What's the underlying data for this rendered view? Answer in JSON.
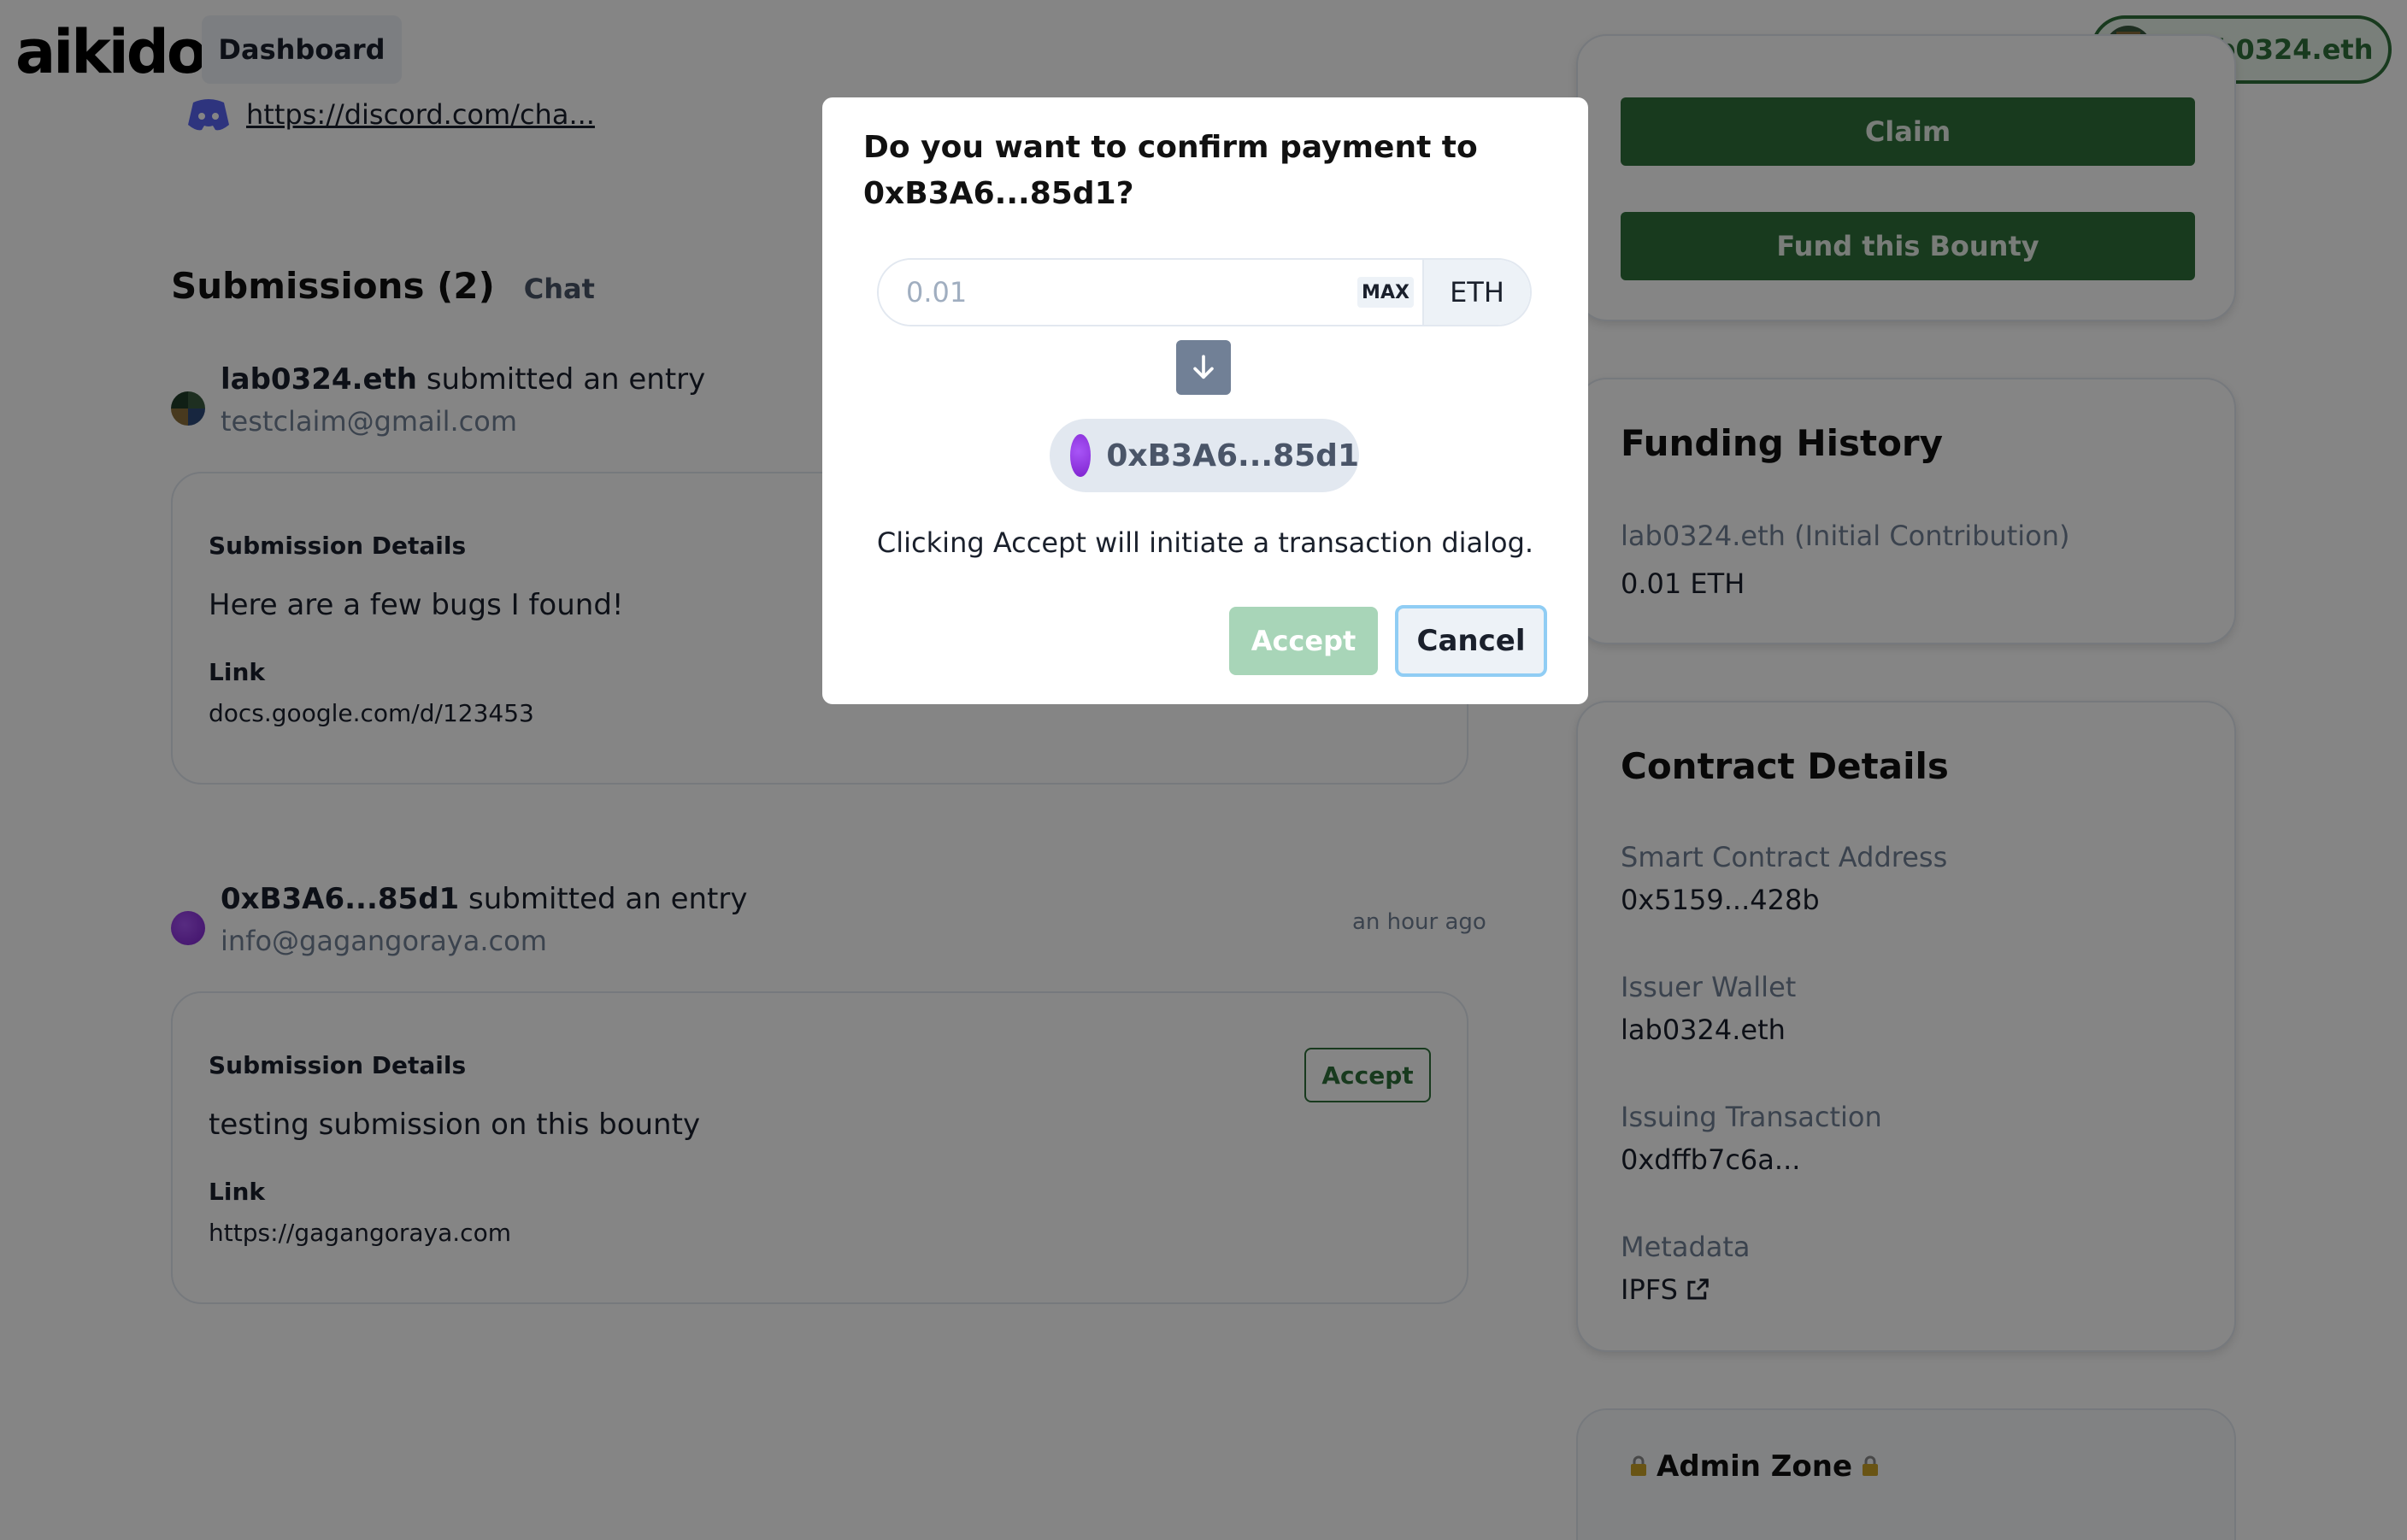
{
  "header": {
    "logo": "aikido",
    "nav_dashboard": "Dashboard",
    "wallet_label": "lab0324.eth"
  },
  "links": {
    "discord": "https://discord.com/cha..."
  },
  "submissions": {
    "title": "Submissions (2)",
    "chat_tab": "Chat",
    "entries": [
      {
        "author": "lab0324.eth",
        "action": "submitted an entry",
        "email": "testclaim@gmail.com",
        "time": "",
        "details_label": "Submission Details",
        "details_text": "Here are a few bugs I found!",
        "link_label": "Link",
        "link_value": "docs.google.com/d/123453",
        "accept_label": ""
      },
      {
        "author": "0xB3A6...85d1",
        "action": "submitted an entry",
        "email": "info@gagangoraya.com",
        "time": "an hour ago",
        "details_label": "Submission Details",
        "details_text": "testing submission on this bounty",
        "link_label": "Link",
        "link_value": "https://gagangoraya.com",
        "accept_label": "Accept"
      }
    ]
  },
  "actions": {
    "claim": "Claim",
    "fund": "Fund this Bounty"
  },
  "funding_history": {
    "title": "Funding History",
    "contributor": "lab0324.eth (Initial Contribution)",
    "amount": "0.01 ETH"
  },
  "contract_details": {
    "title": "Contract Details",
    "address_label": "Smart Contract Address",
    "address_value": "0x5159...428b",
    "issuer_label": "Issuer Wallet",
    "issuer_value": "lab0324.eth",
    "tx_label": "Issuing Transaction",
    "tx_value": "0xdffb7c6a...",
    "metadata_label": "Metadata",
    "metadata_value": "IPFS"
  },
  "admin": {
    "title": "Admin Zone"
  },
  "modal": {
    "title": "Do you want to confirm payment to 0xB3A6...85d1?",
    "amount_placeholder": "0.01",
    "max_label": "MAX",
    "unit": "ETH",
    "recipient": "0xB3A6...85d1",
    "info": "Clicking Accept will initiate a transaction dialog.",
    "accept_label": "Accept",
    "cancel_label": "Cancel"
  },
  "colors": {
    "brand_green": "#2f6f3b",
    "accent_purple": "#7e22ce",
    "focus_blue": "#90cdf4"
  }
}
